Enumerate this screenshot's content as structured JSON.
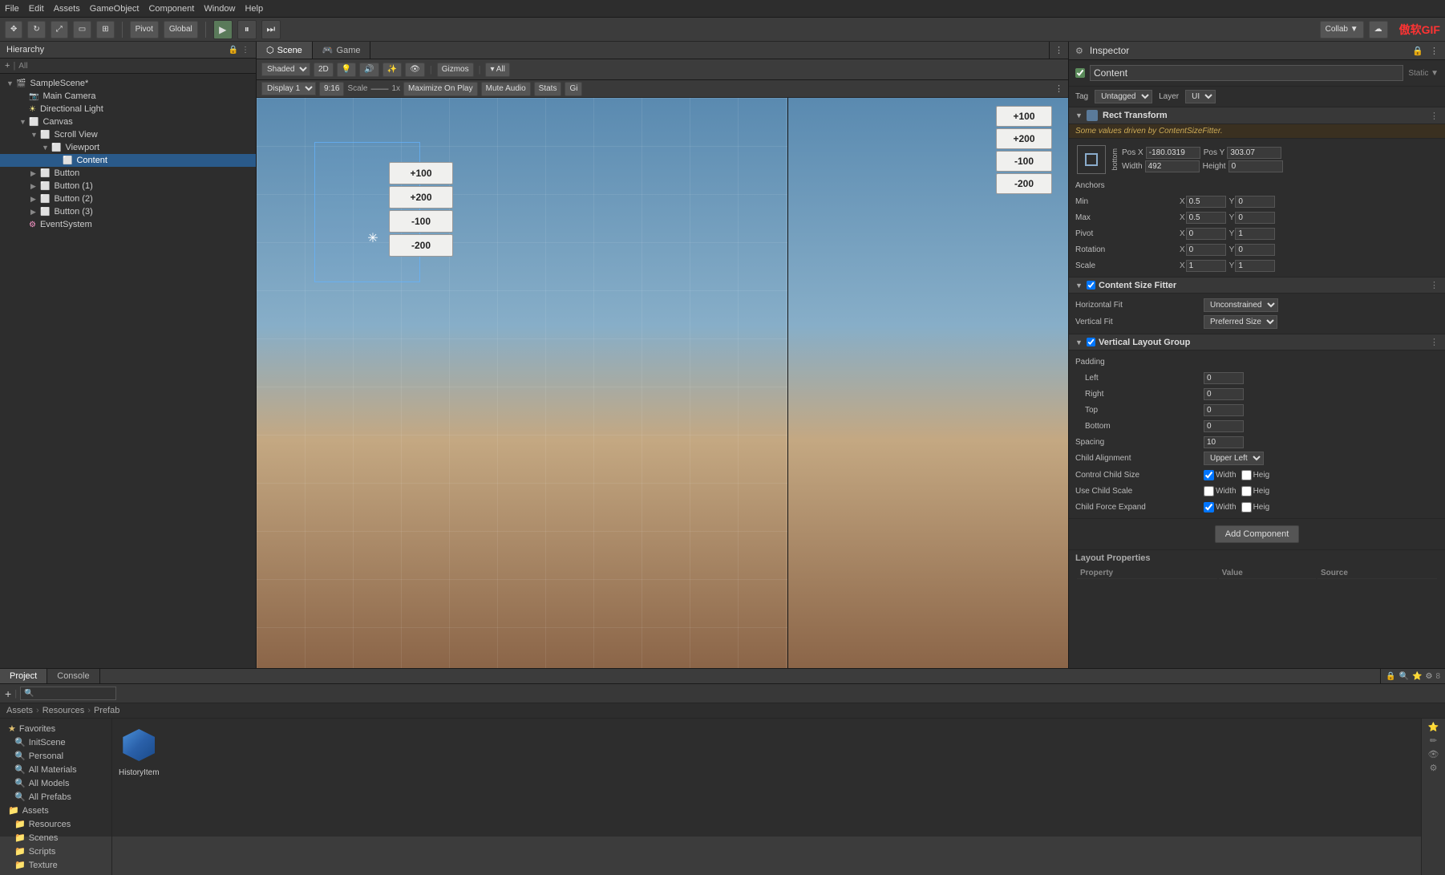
{
  "menubar": {
    "items": [
      "File",
      "Edit",
      "Assets",
      "GameObject",
      "Component",
      "Window",
      "Help"
    ]
  },
  "toolbar": {
    "pivot_label": "Pivot",
    "global_label": "Global",
    "collab_label": "Collab ▼",
    "account_label": "▲",
    "play_icon": "▶",
    "pause_icon": "⏸",
    "step_icon": "⏭"
  },
  "hierarchy": {
    "title": "Hierarchy",
    "search_placeholder": "All",
    "items": [
      {
        "id": "samplescene",
        "label": "SampleScene*",
        "indent": 0,
        "type": "scene",
        "expanded": true
      },
      {
        "id": "maincamera",
        "label": "Main Camera",
        "indent": 1,
        "type": "camera"
      },
      {
        "id": "directionallight",
        "label": "Directional Light",
        "indent": 1,
        "type": "light"
      },
      {
        "id": "canvas",
        "label": "Canvas",
        "indent": 1,
        "type": "canvas",
        "expanded": true
      },
      {
        "id": "scrollview",
        "label": "Scroll View",
        "indent": 2,
        "type": "go",
        "expanded": true
      },
      {
        "id": "viewport",
        "label": "Viewport",
        "indent": 3,
        "type": "go",
        "expanded": true
      },
      {
        "id": "content",
        "label": "Content",
        "indent": 4,
        "type": "go",
        "selected": true
      },
      {
        "id": "button",
        "label": "Button",
        "indent": 2,
        "type": "button"
      },
      {
        "id": "button1",
        "label": "Button (1)",
        "indent": 2,
        "type": "button"
      },
      {
        "id": "button2",
        "label": "Button (2)",
        "indent": 2,
        "type": "button"
      },
      {
        "id": "button3",
        "label": "Button (3)",
        "indent": 2,
        "type": "button"
      },
      {
        "id": "eventsystem",
        "label": "EventSystem",
        "indent": 1,
        "type": "event"
      }
    ]
  },
  "scene": {
    "title": "Scene",
    "shading": "Shaded",
    "mode_2d": "2D",
    "gizmos": "Gizmos",
    "all": "▾ All",
    "buttons": [
      {
        "label": "+100"
      },
      {
        "label": "+200"
      },
      {
        "label": "-100"
      },
      {
        "label": "-200"
      }
    ]
  },
  "game": {
    "title": "Game",
    "display": "Display 1",
    "ratio": "9:16",
    "scale": "Scale",
    "scale_val": "1x",
    "maximize": "Maximize On Play",
    "mute": "Mute Audio",
    "stats": "Stats",
    "gi": "Gi",
    "buttons": [
      {
        "label": "+100"
      },
      {
        "label": "+200"
      },
      {
        "label": "-100"
      },
      {
        "label": "-200"
      }
    ]
  },
  "inspector": {
    "title": "Inspector",
    "component_name": "Content",
    "tag_label": "Tag",
    "tag_value": "Untagged",
    "layer_label": "Layer",
    "layer_value": "UI",
    "rect_transform": {
      "title": "Rect Transform",
      "warning": "Some values driven by ContentSizeFitter.",
      "anchor_preset": "center",
      "pos_x_label": "Pos X",
      "pos_y_label": "Pos Y",
      "pos_x": "-180.0319",
      "pos_y": "303.07",
      "width_label": "Width",
      "height_label": "Height",
      "width": "492",
      "height": "0",
      "anchors_label": "Anchors",
      "min_label": "Min",
      "min_x": "0.5",
      "min_y": "0",
      "max_label": "Max",
      "max_x": "0.5",
      "max_y": "0",
      "pivot_label": "Pivot",
      "pivot_x": "0",
      "pivot_y": "1",
      "rotation_label": "Rotation",
      "rot_x": "0",
      "rot_y": "0",
      "scale_label": "Scale",
      "scale_x": "1",
      "scale_y": "1"
    },
    "content_size_fitter": {
      "title": "Content Size Fitter",
      "horizontal_fit_label": "Horizontal Fit",
      "horizontal_fit": "Unconstrained",
      "vertical_fit_label": "Vertical Fit",
      "vertical_fit": "Preferred Size"
    },
    "vertical_layout_group": {
      "title": "Vertical Layout Group",
      "padding_label": "Padding",
      "left_label": "Left",
      "left_val": "0",
      "right_label": "Right",
      "right_val": "0",
      "top_label": "Top",
      "top_val": "0",
      "bottom_label": "Bottom",
      "bottom_val": "0",
      "spacing_label": "Spacing",
      "spacing_val": "10",
      "child_alignment_label": "Child Alignment",
      "child_alignment_val": "Upper Left",
      "control_child_size_label": "Control Child Size",
      "control_width_label": "Width",
      "control_height_label": "Heig",
      "use_child_scale_label": "Use Child Scale",
      "use_width_label": "Width",
      "use_height_label": "Heig",
      "child_force_expand_label": "Child Force Expand",
      "force_width_label": "Width",
      "force_height_label": "Heig"
    },
    "add_component_btn": "Add Component",
    "layout_props": {
      "title": "Layout Properties",
      "columns": [
        "Property",
        "Value",
        "Source"
      ],
      "rows": []
    }
  },
  "bottom": {
    "project_tab": "Project",
    "console_tab": "Console",
    "project_nav": [
      "Assets",
      "Resources",
      "Prefab"
    ],
    "favorites": {
      "label": "Favorites",
      "items": [
        "InitScene",
        "Personal",
        "All Materials",
        "All Models",
        "All Prefabs"
      ]
    },
    "assets": {
      "label": "Assets",
      "items": [
        "Resources",
        "Scenes",
        "Scripts",
        "Texture"
      ]
    },
    "asset_items": [
      {
        "label": "HistoryItem",
        "type": "cube"
      }
    ]
  },
  "watermark": "傲软GIF"
}
